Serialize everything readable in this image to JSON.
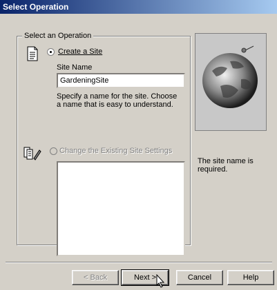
{
  "window": {
    "title": "Select Operation"
  },
  "group": {
    "label": "Select an Operation"
  },
  "create": {
    "radio_label": "Create a Site",
    "site_name_label": "Site Name",
    "site_name_value": "GardeningSite",
    "hint": "Specify a name for the site. Choose a name that is easy to understand."
  },
  "change": {
    "radio_label": "Change the Existing Site Settings"
  },
  "side": {
    "message": "The site name is required."
  },
  "buttons": {
    "back": "< Back",
    "next": "Next >",
    "cancel": "Cancel",
    "help": "Help"
  },
  "icons": {
    "create_icon": "document-icon",
    "change_icon": "edit-documents-icon",
    "globe": "globe-image"
  }
}
